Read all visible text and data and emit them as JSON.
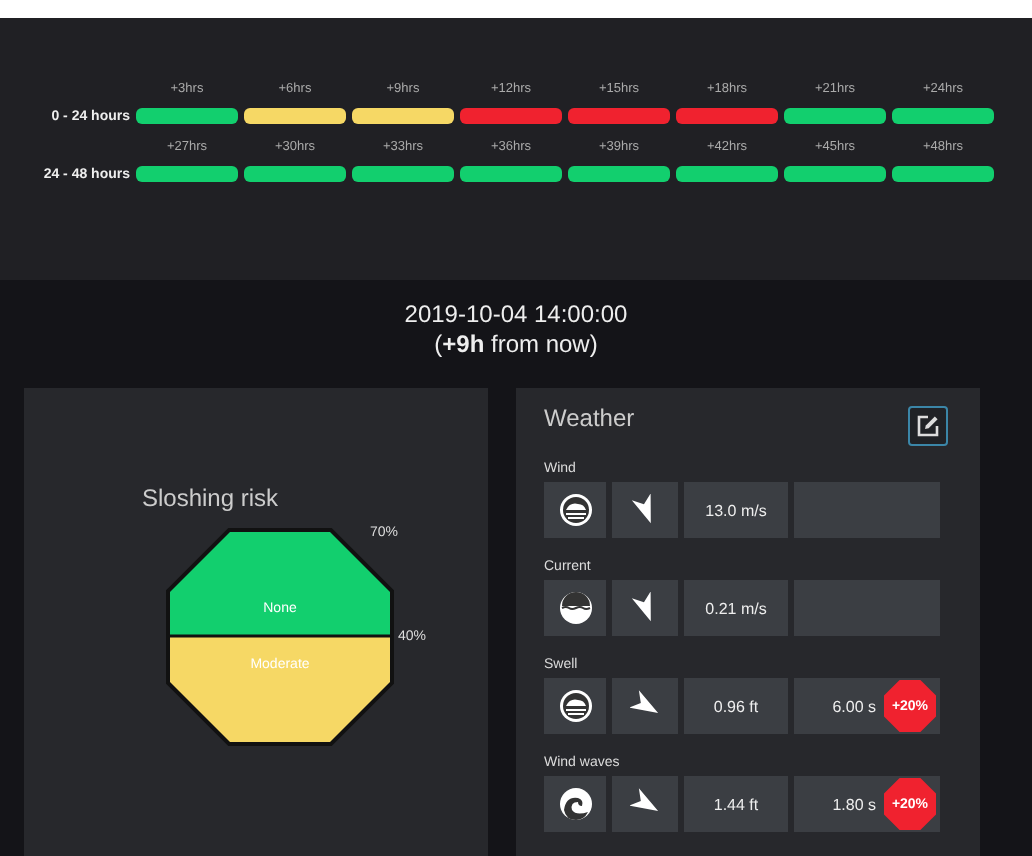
{
  "timeline": {
    "rows": [
      {
        "label": "0 - 24 hours",
        "cells": [
          {
            "label": "+3hrs",
            "color": "#12cf6e"
          },
          {
            "label": "+6hrs",
            "color": "#f6d865"
          },
          {
            "label": "+9hrs",
            "color": "#f6d865"
          },
          {
            "label": "+12hrs",
            "color": "#f0222f"
          },
          {
            "label": "+15hrs",
            "color": "#f0222f"
          },
          {
            "label": "+18hrs",
            "color": "#f0222f"
          },
          {
            "label": "+21hrs",
            "color": "#12cf6e"
          },
          {
            "label": "+24hrs",
            "color": "#12cf6e"
          }
        ]
      },
      {
        "label": "24 - 48 hours",
        "cells": [
          {
            "label": "+27hrs",
            "color": "#12cf6e"
          },
          {
            "label": "+30hrs",
            "color": "#12cf6e"
          },
          {
            "label": "+33hrs",
            "color": "#12cf6e"
          },
          {
            "label": "+36hrs",
            "color": "#12cf6e"
          },
          {
            "label": "+39hrs",
            "color": "#12cf6e"
          },
          {
            "label": "+42hrs",
            "color": "#12cf6e"
          },
          {
            "label": "+45hrs",
            "color": "#12cf6e"
          },
          {
            "label": "+48hrs",
            "color": "#12cf6e"
          }
        ]
      }
    ]
  },
  "time": {
    "datetime": "2019-10-04 14:00:00",
    "relative": "(**+9h** from now)"
  },
  "sloshing": {
    "title": "Sloshing risk",
    "thresholds": [
      "70%",
      "40%"
    ],
    "segments": [
      {
        "label": "None",
        "color": "#12cf6e"
      },
      {
        "label": "Moderate",
        "color": "#f6d865"
      }
    ]
  },
  "weather": {
    "title": "Weather",
    "params": [
      {
        "kind": "wind",
        "label": "Wind",
        "values": [
          "13.0 m/s"
        ]
      },
      {
        "kind": "current",
        "label": "Current",
        "values": [
          "0.21 m/s"
        ]
      },
      {
        "kind": "swell",
        "label": "Swell",
        "values": [
          "0.96 ft",
          "6.00 s"
        ],
        "badge": "+20%"
      },
      {
        "kind": "wind_waves",
        "label": "Wind waves",
        "values": [
          "1.44 ft",
          "1.80 s"
        ],
        "badge": "+20%"
      }
    ]
  }
}
